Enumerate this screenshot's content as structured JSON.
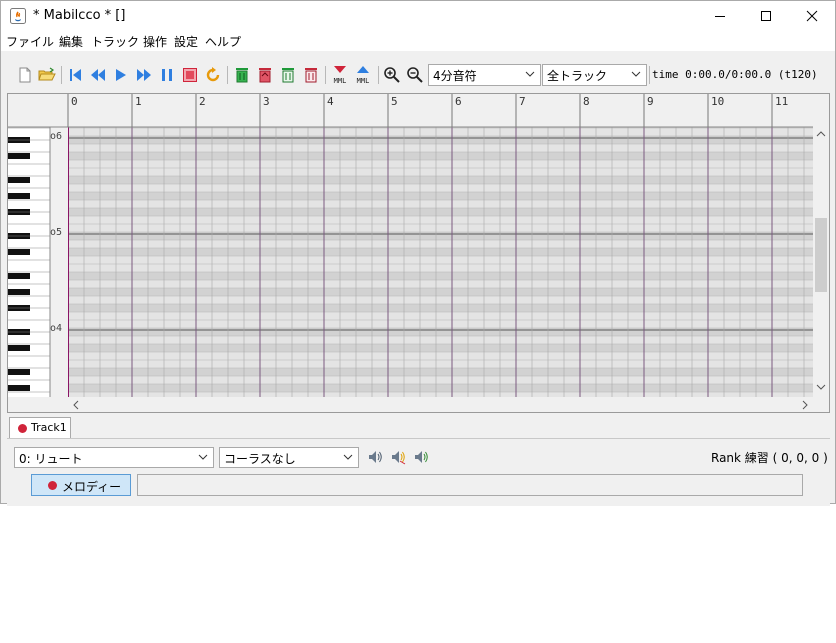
{
  "window": {
    "title": "* Mabilcco * []"
  },
  "menu": [
    "ファイル",
    "編集",
    "トラック",
    "操作",
    "設定",
    "ヘルプ"
  ],
  "toolbar": {
    "note_length": "4分音符",
    "track_filter": "全トラック",
    "time_display": "time 0:00.0/0:00.0 (t120)",
    "mml_label": "MML"
  },
  "piano_roll": {
    "measures": [
      "0",
      "1",
      "2",
      "3",
      "4",
      "5",
      "6",
      "7",
      "8",
      "9",
      "10",
      "11"
    ],
    "octaves": [
      "o6",
      "o5",
      "o4"
    ]
  },
  "tabs": [
    "Track1"
  ],
  "track": {
    "instrument": "0: リュート",
    "chorus": "コーラスなし",
    "rank": "Rank 練習 ( 0, 0, 0 )",
    "part_button": "メロディー",
    "mml_text": ""
  },
  "colors": {
    "accent_red": "#d0243a",
    "button_blue": "#cfe6f8",
    "playhead": "#8a1466"
  }
}
